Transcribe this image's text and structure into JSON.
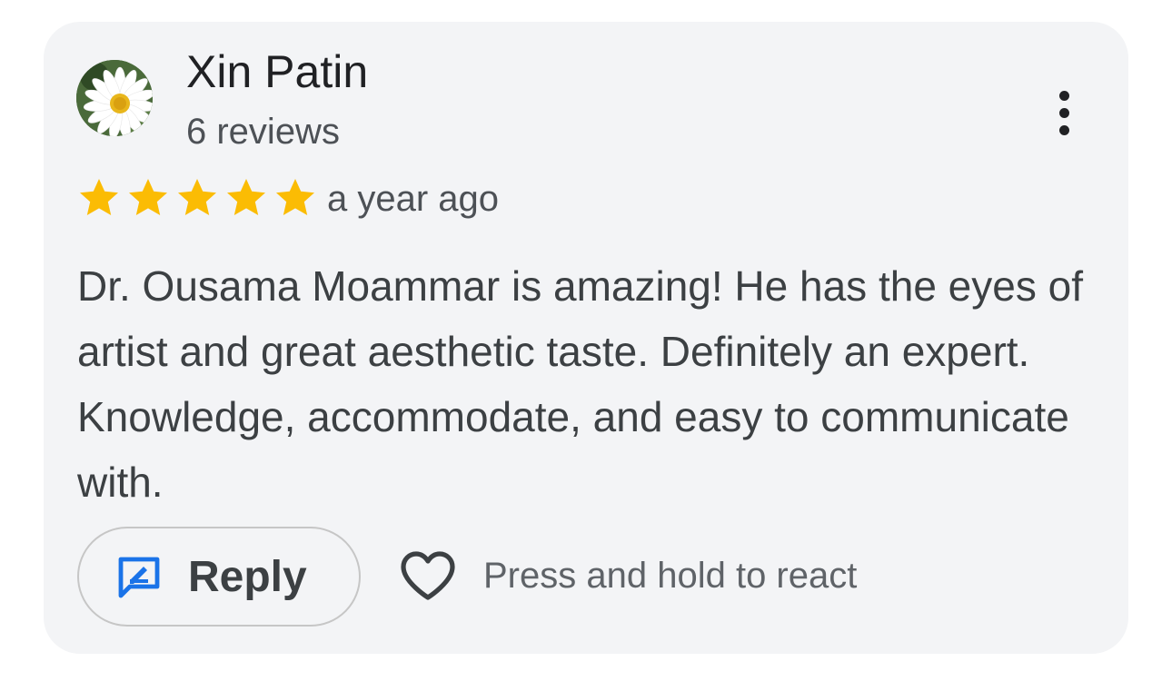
{
  "review": {
    "author": {
      "name": "Xin Patin",
      "review_count": "6 reviews",
      "avatar_icon": "daisy-flower-avatar"
    },
    "rating": {
      "stars": 5,
      "max_stars": 5,
      "color": "#fbbc04"
    },
    "timestamp": "a year ago",
    "text": "Dr. Ousama Moammar is amazing! He has the eyes of artist and great aesthetic taste. Definitely an expert. Knowledge, accommodate, and easy to communicate with.",
    "actions": {
      "reply_label": "Reply",
      "reply_icon": "reply-edit-icon",
      "reply_icon_color": "#1a73e8",
      "react_label": "Press and hold to react",
      "react_icon": "heart-outline-icon",
      "more_icon": "more-vertical-icon"
    }
  }
}
